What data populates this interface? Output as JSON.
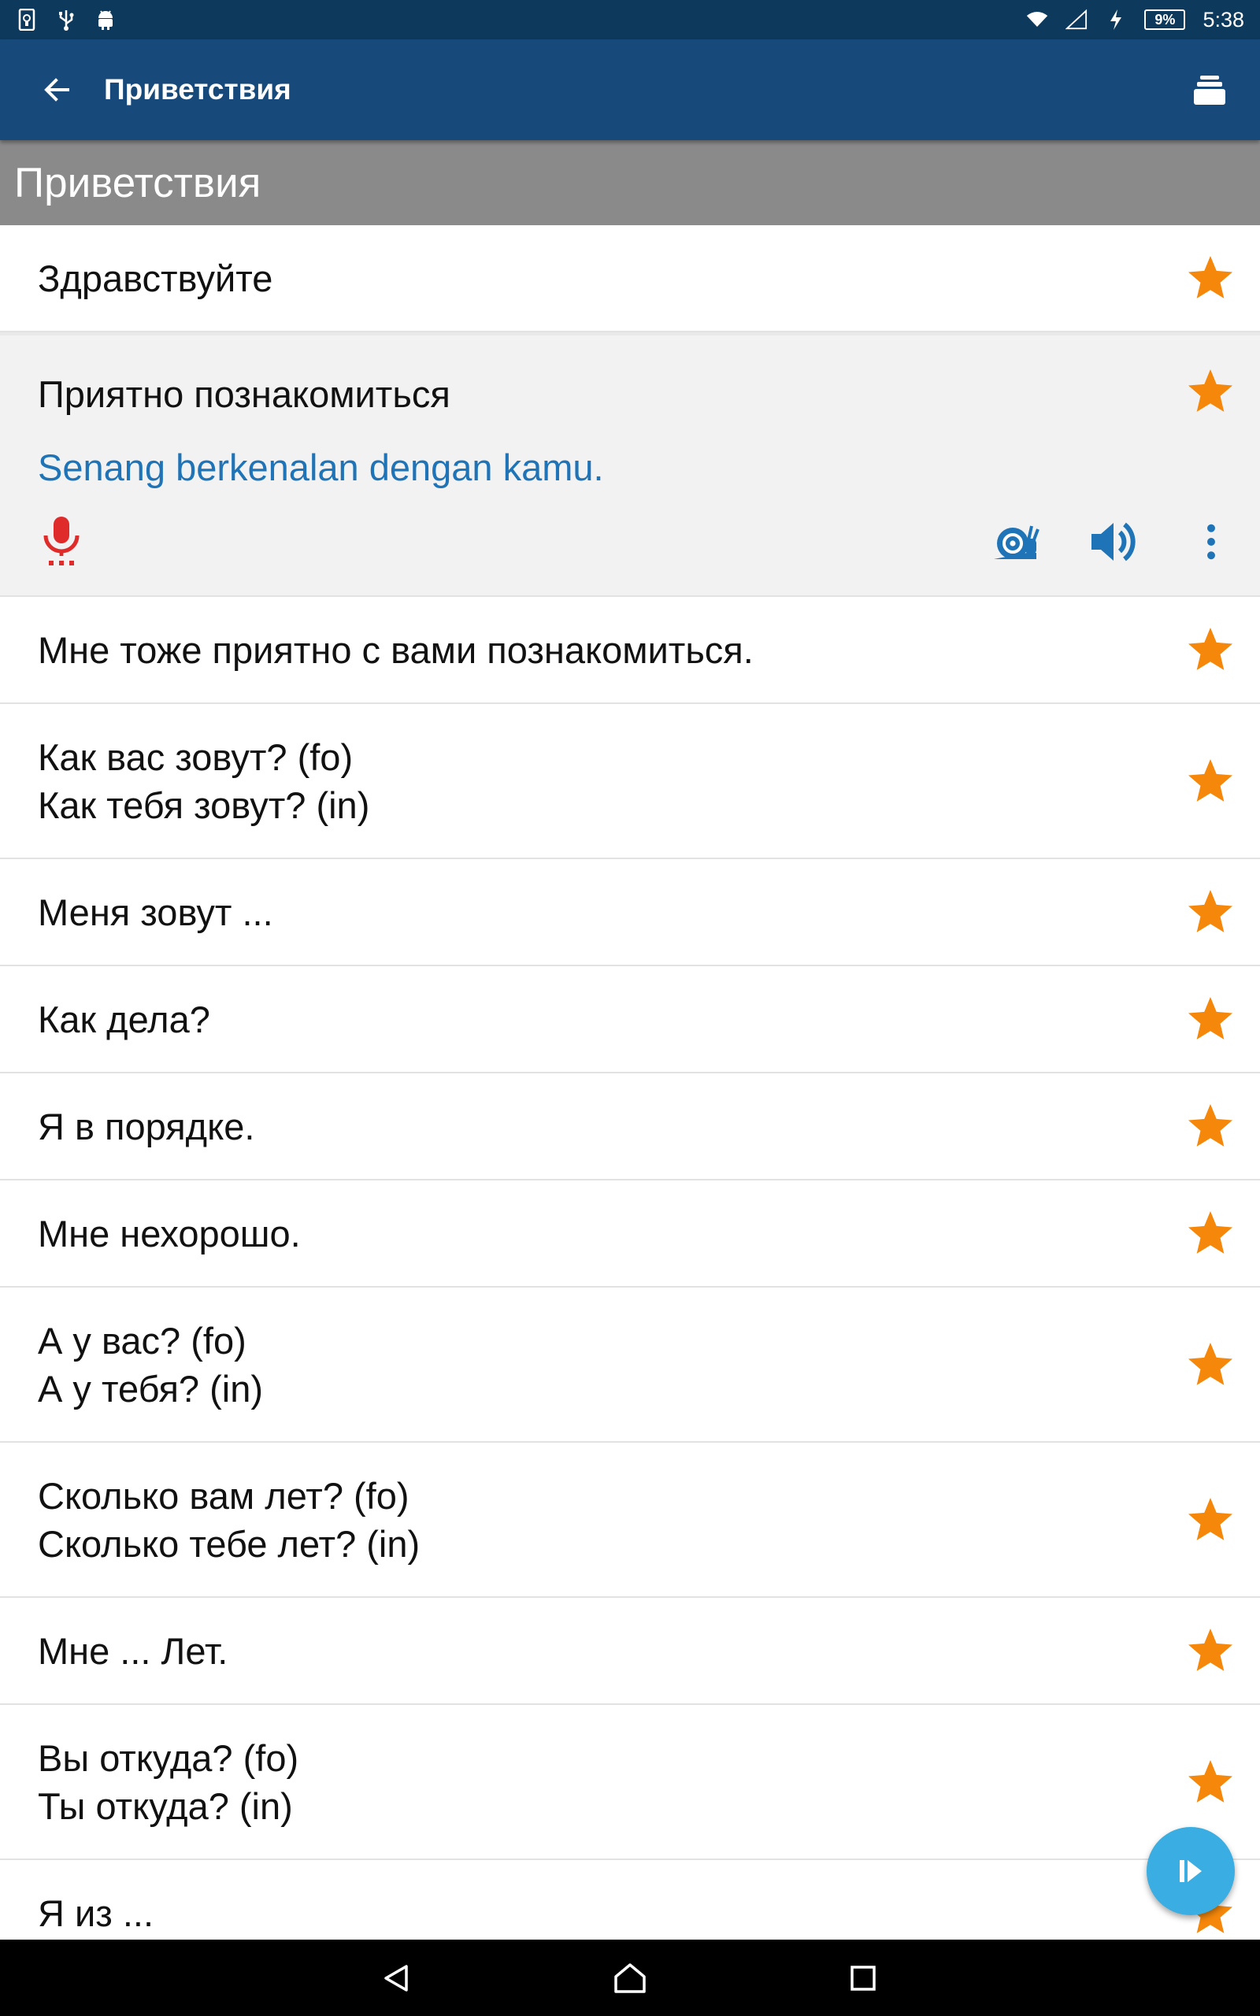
{
  "status_bar": {
    "icons_left": [
      "usb-debug-icon",
      "usb-icon",
      "android-icon"
    ],
    "icons_right": [
      "wifi-icon",
      "signal-icon",
      "charging-icon"
    ],
    "battery": "9%",
    "time": "5:38"
  },
  "app_bar": {
    "title": "Приветствия",
    "back_icon": "arrow-left-icon",
    "action_icon": "card-stack-icon"
  },
  "section_header": "Приветствия",
  "phrases": [
    {
      "lines": [
        "Здравствуйте"
      ]
    },
    {
      "lines": [
        "Приятно познакомиться"
      ],
      "translation": "Senang berkenalan dengan kamu.",
      "expanded": true
    },
    {
      "lines": [
        "Мне тоже приятно с вами познакомиться."
      ]
    },
    {
      "lines": [
        "Как вас зовут? (fo)",
        "Как тебя зовут? (in)"
      ]
    },
    {
      "lines": [
        "Меня зовут ..."
      ]
    },
    {
      "lines": [
        "Как дела?"
      ]
    },
    {
      "lines": [
        "Я в порядке."
      ]
    },
    {
      "lines": [
        "Мне нехорошо."
      ]
    },
    {
      "lines": [
        "А у вас? (fo)",
        "А у тебя? (in)"
      ]
    },
    {
      "lines": [
        "Сколько вам лет? (fo)",
        "Сколько тебе лет? (in)"
      ]
    },
    {
      "lines": [
        "Мне ... Лет."
      ]
    },
    {
      "lines": [
        "Вы откуда? (fo)",
        "Ты откуда? (in)"
      ]
    },
    {
      "lines": [
        "Я из ..."
      ]
    }
  ],
  "colors": {
    "status_bar": "#0d3a5c",
    "app_bar": "#17497a",
    "section_header": "#8a8a8a",
    "star": "#f5870a",
    "translation": "#1f73b7",
    "mic": "#e02b2b",
    "audio": "#1f73b7",
    "fab": "#3aaee2"
  },
  "expanded_actions": [
    "microphone-icon",
    "snail-slow-play-icon",
    "speaker-icon",
    "more-vert-icon"
  ],
  "fab_icon": "play-icon",
  "nav": [
    "back-triangle-icon",
    "home-icon",
    "recents-square-icon"
  ]
}
